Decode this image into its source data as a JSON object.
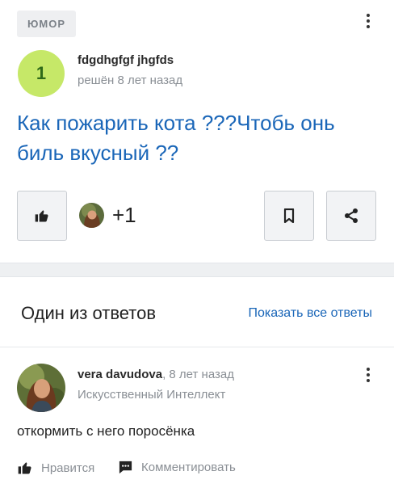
{
  "question": {
    "category": "ЮМОР",
    "author_badge": "1",
    "author": "fdgdhgfgf jhgfds",
    "status": "решён 8 лет назад",
    "title": "Как пожарить кота ???Чтобь онь биль вкусный ??",
    "likes_extra": "+1",
    "icons": [
      "thumbs-up-icon",
      "bookmark-icon",
      "share-icon",
      "more-vertical-icon"
    ]
  },
  "answers_section": {
    "header": "Один из ответов",
    "show_all": "Показать все ответы",
    "answer": {
      "author": "vera davudova",
      "time": ", 8 лет назад",
      "role": "Искусственный Интеллект",
      "text": "откормить с него поросёнка",
      "like_label": "Нравится",
      "comment_label": "Комментировать"
    }
  },
  "colors": {
    "link": "#1a66b8",
    "badge_bg": "#c6e868",
    "badge_fg": "#2f6a19",
    "muted": "#8a8f95"
  }
}
